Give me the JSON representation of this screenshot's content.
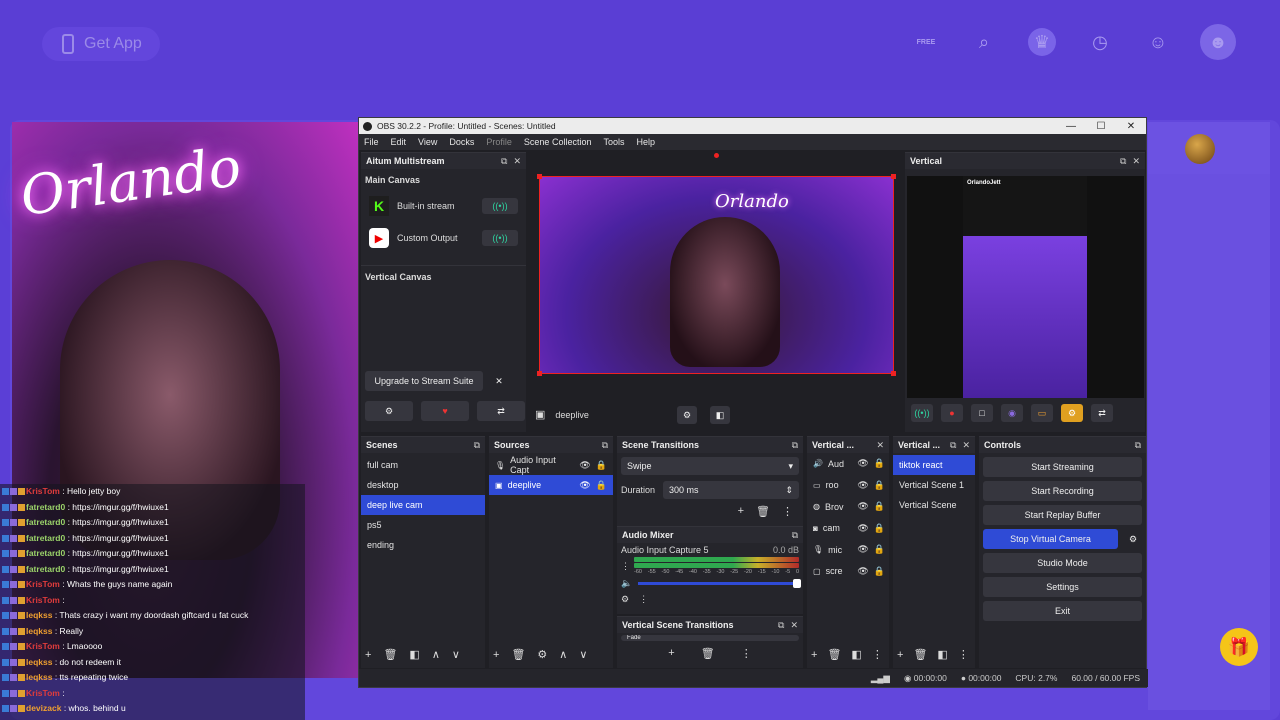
{
  "site": {
    "get_app": "Get App",
    "icons": [
      "free-icon",
      "search-icon",
      "crown-icon",
      "clock-icon",
      "chat-icon",
      "avatar"
    ],
    "free_badge": "FREE"
  },
  "stream": {
    "neon_text": "Orlando"
  },
  "chat": {
    "messages": [
      {
        "user": "KrisTom",
        "text": ": Hello jetty boy",
        "color": "#e03c3c"
      },
      {
        "user": "fatretard0",
        "text": ": https://imgur.gg/f/hwiuxe1",
        "color": "#9bd36a"
      },
      {
        "user": "fatretard0",
        "text": ": https://imgur.gg/f/hwiuxe1",
        "color": "#9bd36a"
      },
      {
        "user": "fatretard0",
        "text": ": https://imgur.gg/f/hwiuxe1",
        "color": "#9bd36a"
      },
      {
        "user": "fatretard0",
        "text": ": https://imgur.gg/f/hwiuxe1",
        "color": "#9bd36a"
      },
      {
        "user": "fatretard0",
        "text": ": https://imgur.gg/f/hwiuxe1",
        "color": "#9bd36a"
      },
      {
        "user": "KrisTom",
        "text": ": Whats the guys name again",
        "color": "#e03c3c"
      },
      {
        "user": "KrisTom",
        "text": ":",
        "color": "#e03c3c"
      },
      {
        "user": "leqkss",
        "text": ": Thats crazy i want my doordash giftcard u fat cuck",
        "color": "#f0a030"
      },
      {
        "user": "leqkss",
        "text": ": Really",
        "color": "#f0a030"
      },
      {
        "user": "KrisTom",
        "text": ": Lmaoooo",
        "color": "#e03c3c"
      },
      {
        "user": "leqkss",
        "text": ": do not redeem it",
        "color": "#f0a030"
      },
      {
        "user": "leqkss",
        "text": ": tts repeating twice",
        "color": "#f0a030"
      },
      {
        "user": "KrisTom",
        "text": ":",
        "color": "#e03c3c"
      },
      {
        "user": "devizack",
        "text": ": whos. behind u",
        "color": "#f0a030"
      }
    ]
  },
  "obs": {
    "title": "OBS 30.2.2 - Profile: Untitled - Scenes: Untitled",
    "menu": [
      "File",
      "Edit",
      "View",
      "Docks",
      "Profile",
      "Scene Collection",
      "Tools",
      "Help"
    ],
    "multistream": {
      "title": "Aitum Multistream",
      "main_canvas": "Main Canvas",
      "outputs": [
        {
          "label": "Built-in stream",
          "icon": "kick-icon"
        },
        {
          "label": "Custom Output",
          "icon": "youtube-icon"
        }
      ],
      "vertical_canvas": "Vertical Canvas",
      "upgrade": "Upgrade to Stream Suite"
    },
    "preview": {
      "scene_label": "deeplive",
      "neon": "Orlando"
    },
    "vertical": {
      "title": "Vertical",
      "channel": "OrlandoJett"
    },
    "scenes": {
      "title": "Scenes",
      "items": [
        "full cam",
        "desktop",
        "deep live cam",
        "ps5",
        "ending"
      ],
      "selected": 2
    },
    "sources": {
      "title": "Sources",
      "items": [
        "Audio Input Capt",
        "deeplive"
      ],
      "selected": 1
    },
    "transitions": {
      "title": "Scene Transitions",
      "type": "Swipe",
      "duration_label": "Duration",
      "duration": "300 ms"
    },
    "mixer": {
      "title": "Audio Mixer",
      "channel": "Audio Input Capture 5",
      "level": "0.0 dB",
      "ticks": [
        "-60",
        "-55",
        "-50",
        "-45",
        "-40",
        "-35",
        "-30",
        "-25",
        "-20",
        "-15",
        "-10",
        "-5",
        "0"
      ]
    },
    "vertical_transitions": {
      "title": "Vertical Scene Transitions",
      "type": "Fade"
    },
    "vsources": {
      "title": "Vertical ...",
      "items": [
        "Aud",
        "roo",
        "Brov",
        "cam",
        "mic",
        "scre"
      ]
    },
    "vscenes": {
      "title": "Vertical ...",
      "items": [
        "tiktok react",
        "Vertical Scene 1",
        "Vertical Scene"
      ],
      "selected": 0
    },
    "controls": {
      "title": "Controls",
      "buttons": [
        "Start Streaming",
        "Start Recording",
        "Start Replay Buffer",
        "Stop Virtual Camera",
        "Studio Mode",
        "Settings",
        "Exit"
      ],
      "active": 3
    },
    "status": {
      "rec_time": "00:00:00",
      "stream_time": "00:00:00",
      "cpu": "CPU: 2.7%",
      "fps": "60.00 / 60.00 FPS"
    }
  }
}
